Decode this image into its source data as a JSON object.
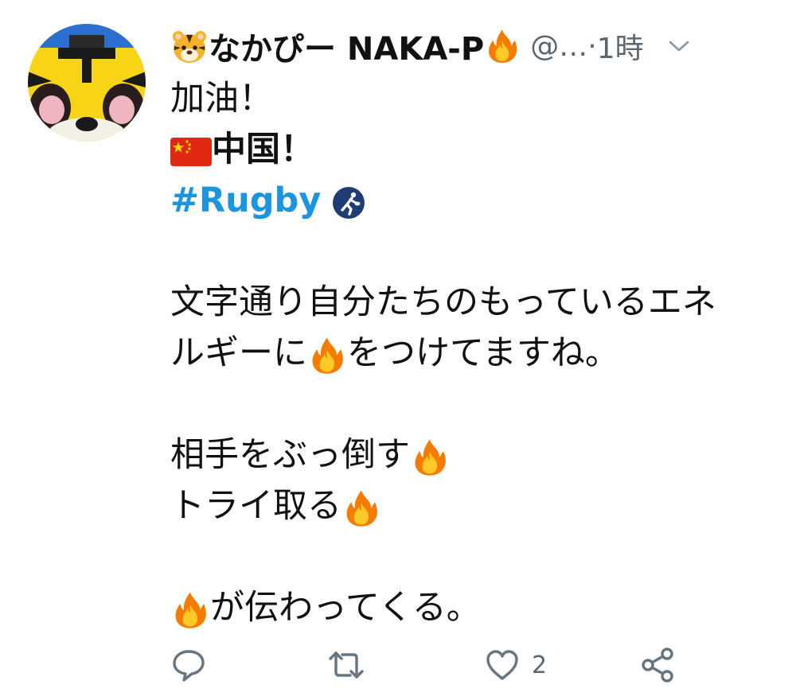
{
  "tweet": {
    "author": {
      "name": "なかぴー NAKA-P",
      "handle": "@…",
      "separator": " · ",
      "time": "1時"
    },
    "lines": [
      "加油！",
      "中国！",
      "#Rugby",
      "",
      "文字通り自分たちのもっているエネ",
      "ルギーに",
      "をつけてますね。",
      "",
      "相手をぶっ倒す",
      "トライ取る",
      "",
      "が伝わってくる。"
    ],
    "actions": {
      "reply": "",
      "retweet": "",
      "like_count": "2",
      "share": ""
    }
  },
  "colors": {
    "hashtag": "#1b95e0",
    "secondary_text": "#5b6670",
    "icon_gray": "#66757f"
  },
  "icons": [
    "tiger-emoji",
    "fire-emoji",
    "china-flag-emoji",
    "rugby-icon",
    "chevron-down-icon",
    "reply-icon",
    "retweet-icon",
    "heart-icon",
    "share-icon"
  ]
}
